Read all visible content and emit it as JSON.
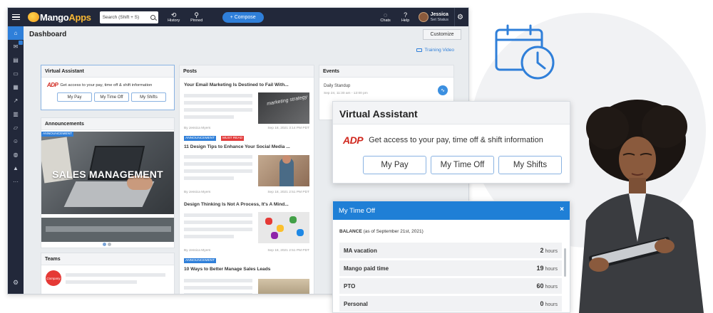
{
  "app": {
    "brand_left": "Mango",
    "brand_right": "Apps",
    "search_placeholder": "Search (Shift + S)",
    "nav": [
      {
        "label": "History",
        "icon": "history-icon"
      },
      {
        "label": "Pinned",
        "icon": "pin-icon"
      }
    ],
    "compose_label": "+ Compose",
    "right_nav": [
      {
        "label": "Chats",
        "icon": "chat-icon"
      },
      {
        "label": "Help",
        "icon": "help-icon"
      }
    ],
    "user": {
      "name": "Jessica",
      "status": "Set Status"
    }
  },
  "dashboard": {
    "title": "Dashboard",
    "customize_label": "Customize",
    "training_label": "Training Video"
  },
  "virtual_assistant": {
    "title": "Virtual Assistant",
    "adp": "ADP",
    "description": "Get access to your pay, time off & shift information",
    "buttons": [
      "My Pay",
      "My Time Off",
      "My Shifts"
    ]
  },
  "announcements": {
    "title": "Announcements",
    "tag": "ANNOUNCEMENT",
    "image_text": "SALES MANAGEMENT"
  },
  "teams": {
    "title": "Teams",
    "logo_text": "Company"
  },
  "posts": {
    "title": "Posts",
    "items": [
      {
        "title": "Your Email Marketing Is Destined to Fail With...",
        "author": "By Jessica Myers",
        "date": "Sep 18, 2021 3:14 PM PDT",
        "thumb_text": "marketing strategy"
      },
      {
        "title": "11 Design Tips to Enhance Your Social Media ...",
        "author": "By Jessica Myers",
        "date": "Sep 18, 2021 2:51 PM PDT",
        "tags": [
          "ANNOUNCEMENT",
          "MUST READ"
        ]
      },
      {
        "title": "Design Thinking Is Not A Process, It's A Mind...",
        "author": "By Jessica Myers",
        "date": "Sep 18, 2021 2:51 PM PDT"
      },
      {
        "title": "10 Ways to Better Manage Sales Leads",
        "tags": [
          "ANNOUNCEMENT"
        ]
      }
    ]
  },
  "events": {
    "title": "Events",
    "item": {
      "title": "Daily Standup",
      "date": "Sep 24, 11:30 am - 12:00 pm"
    }
  },
  "my_time_off": {
    "title": "My Time Off",
    "close": "×",
    "balance_label": "BALANCE",
    "balance_date": "(as of September 21st, 2021)",
    "rows": [
      {
        "label": "MA vacation",
        "value": "2",
        "unit": "hours"
      },
      {
        "label": "Mango paid time",
        "value": "19",
        "unit": "hours"
      },
      {
        "label": "PTO",
        "value": "60",
        "unit": "hours"
      },
      {
        "label": "Personal",
        "value": "0",
        "unit": "hours"
      }
    ]
  },
  "colors": {
    "topbar": "#22283a",
    "accent": "#2f7fd9",
    "adp_red": "#d0271d",
    "time_off_header": "#1f7fd6"
  }
}
